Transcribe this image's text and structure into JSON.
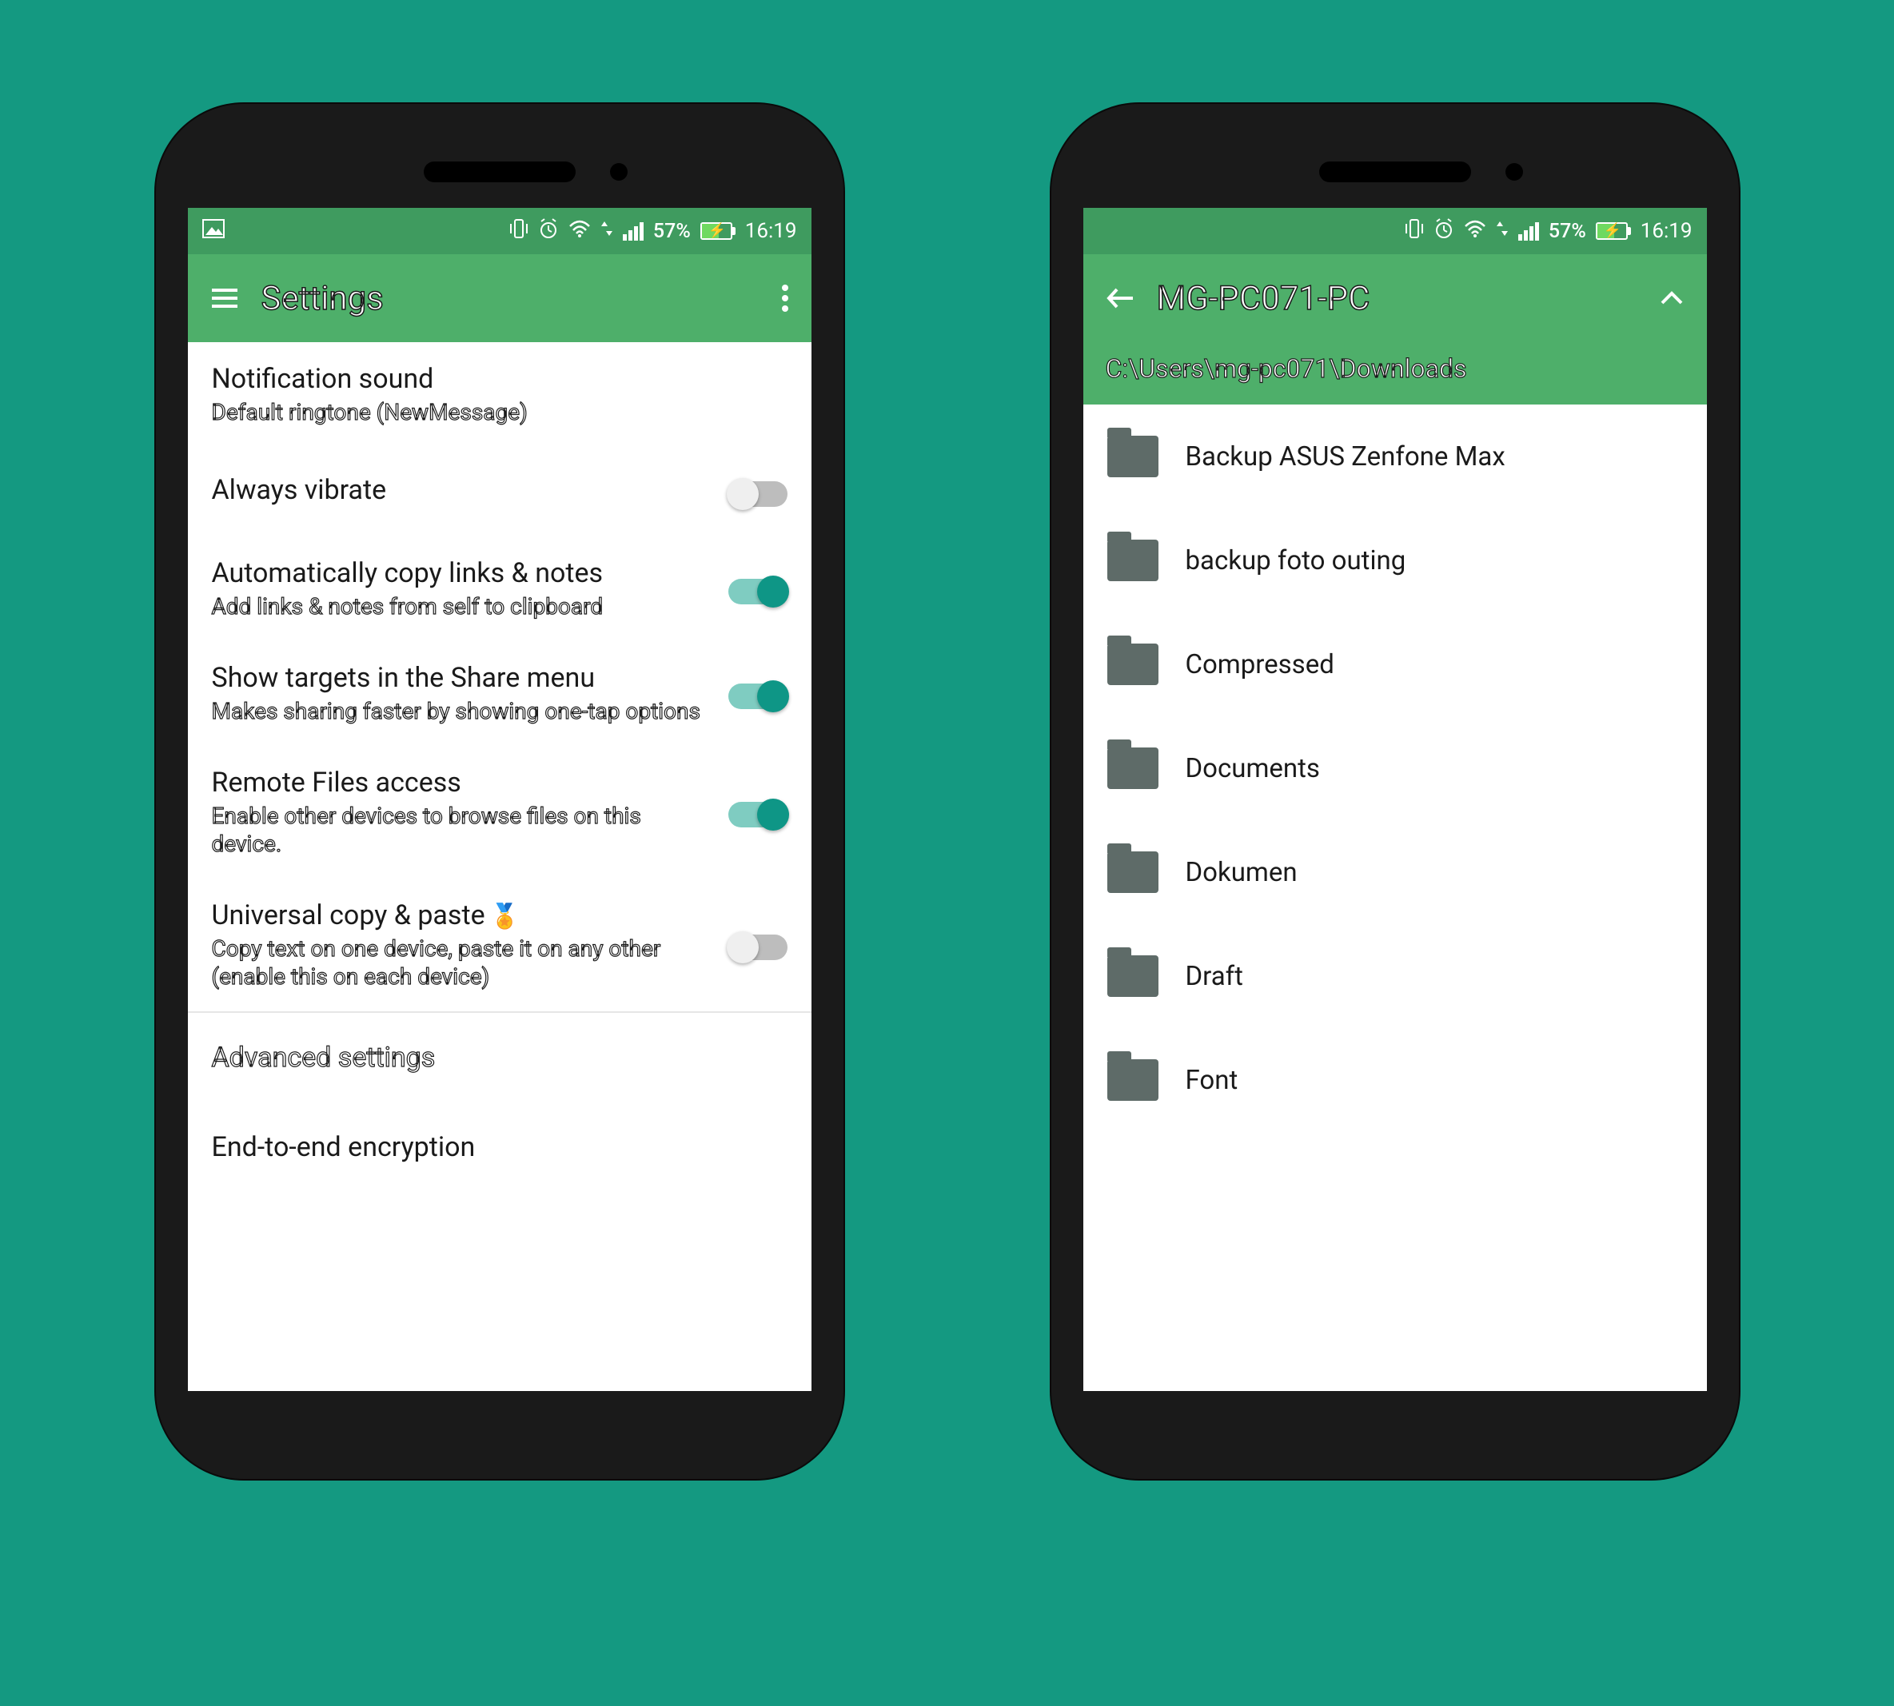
{
  "status": {
    "battery_text": "57%",
    "time": "16:19"
  },
  "phone1": {
    "title": "Settings",
    "items": [
      {
        "title": "Notification sound",
        "sub": "Default ringtone (NewMessage)",
        "toggle": null
      },
      {
        "title": "Always vibrate",
        "sub": "",
        "toggle": "off"
      },
      {
        "title": "Automatically copy links & notes",
        "sub": "Add links & notes from self to clipboard",
        "toggle": "on"
      },
      {
        "title": "Show targets in the Share menu",
        "sub": "Makes sharing faster by showing one-tap options",
        "toggle": "on"
      },
      {
        "title": "Remote Files access",
        "sub": "Enable other devices to browse files on this device.",
        "toggle": "on"
      },
      {
        "title": "Universal copy & paste",
        "sub": "Copy text on one device, paste it on any other (enable this on each device)",
        "toggle": "off",
        "badge": "🏅"
      }
    ],
    "advanced": "Advanced settings",
    "e2e": "End-to-end encryption"
  },
  "phone2": {
    "title": "MG-PC071-PC",
    "path": "C:\\Users\\mg-pc071\\Downloads",
    "folders": [
      "Backup ASUS Zenfone Max",
      "backup foto outing",
      "Compressed",
      "Documents",
      "Dokumen",
      "Draft",
      "Font"
    ]
  }
}
